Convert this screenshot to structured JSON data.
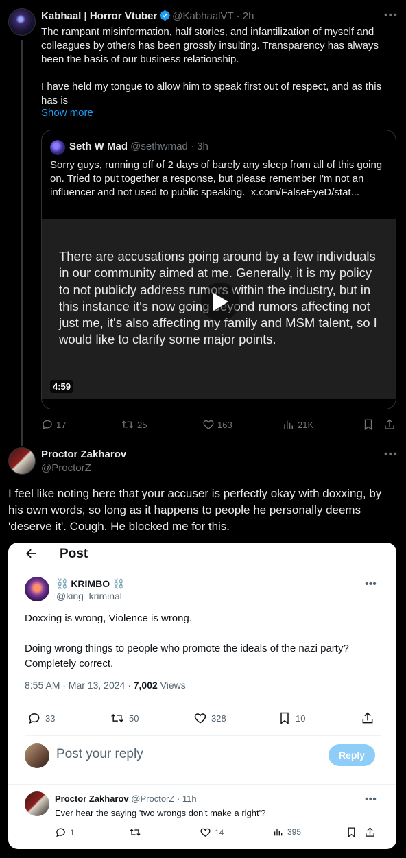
{
  "tweet1": {
    "author_name": "Kabhaal | Horror Vtuber",
    "handle": "@KabhaalVT",
    "time": "· 2h",
    "paragraph1": "The rampant misinformation, half stories, and infantilization of myself and colleagues by others has been grossly insulting. Transparency has always been the basis of our business relationship.",
    "paragraph2": "I have held my tongue to allow him to speak first out of respect, and as this has is",
    "show_more": "Show more",
    "quote": {
      "author_name": "Seth W Mad",
      "handle": "@sethwmad",
      "time": "· 3h",
      "text": "Sorry guys, running off of 2 days of barely any sleep from all of this going on. Tried to put together a response, but please remember I'm not an influencer and not used to public speaking.",
      "link": "x.com/FalseEyeD/stat...",
      "video_text": "There are accusations going around by a few individuals in our community aimed at me. Generally, it is my policy to not publicly address rumors within the industry, but in this instance it's now going beyond rumors affecting not just me, it's also affecting my family and MSM talent, so I would like to clarify some major points.",
      "duration": "4:59"
    },
    "actions": {
      "replies": "17",
      "reposts": "25",
      "likes": "163",
      "views": "21K"
    }
  },
  "tweet2": {
    "author_name": "Proctor Zakharov",
    "handle": "@ProctorZ",
    "text": "I feel like noting here that your accuser is perfectly okay with doxxing, by his own words, so long as it happens to people he personally deems 'deserve it'. Cough. He blocked me for this.",
    "screenshot": {
      "header_title": "Post",
      "author_name": "⛓️ KRIMBO ⛓️",
      "handle": "@king_kriminal",
      "paragraph1": "Doxxing is wrong, Violence is wrong.",
      "paragraph2": "Doing wrong things to people who promote the ideals of the nazi party? Completely correct.",
      "timestamp": "8:55 AM · Mar 13, 2024 · ",
      "views_count": "7,002",
      "views_label": " Views",
      "actions": {
        "replies": "33",
        "reposts": "50",
        "likes": "328",
        "bookmarks": "10"
      },
      "reply_placeholder": "Post your reply",
      "reply_button": "Reply",
      "reply": {
        "author_name": "Proctor Zakharov",
        "handle": "@ProctorZ",
        "time": "· 11h",
        "text": "Ever hear the saying 'two wrongs don't make a right'?",
        "actions": {
          "replies": "1",
          "likes": "14",
          "views": "395"
        }
      }
    }
  },
  "colors": {
    "background": "#000000",
    "text": "#e7e9ea",
    "muted": "#71767b",
    "link": "#1d9bf0",
    "verified": "#1d9bf0",
    "reply_button": "#8ecdf8"
  }
}
